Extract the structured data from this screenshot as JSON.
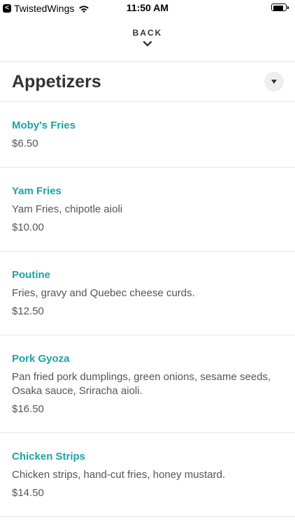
{
  "status_bar": {
    "back_app_glyph": "<",
    "carrier": "TwistedWings",
    "time": "11:50 AM",
    "battery_level": 0.9
  },
  "header": {
    "back_label": "BACK"
  },
  "section": {
    "title": "Appetizers"
  },
  "colors": {
    "accent": "#1ba3a8",
    "text": "#333333",
    "muted": "#555555",
    "divider": "#e6e6e6"
  },
  "icons": {
    "wifi": "wifi-icon",
    "chevron": "chevron-down-icon",
    "dropdown": "caret-down-icon",
    "battery": "battery-icon"
  },
  "items": [
    {
      "name": "Moby's Fries",
      "description": "",
      "price": "$6.50"
    },
    {
      "name": "Yam Fries",
      "description": "Yam Fries, chipotle aioli",
      "price": "$10.00"
    },
    {
      "name": "Poutine",
      "description": "Fries, gravy and Quebec cheese curds.",
      "price": "$12.50"
    },
    {
      "name": "Pork Gyoza",
      "description": "Pan fried pork dumplings, green onions, sesame seeds, Osaka sauce, Sriracha aioli.",
      "price": "$16.50"
    },
    {
      "name": "Chicken Strips",
      "description": "Chicken strips, hand-cut fries, honey mustard.",
      "price": "$14.50"
    }
  ]
}
